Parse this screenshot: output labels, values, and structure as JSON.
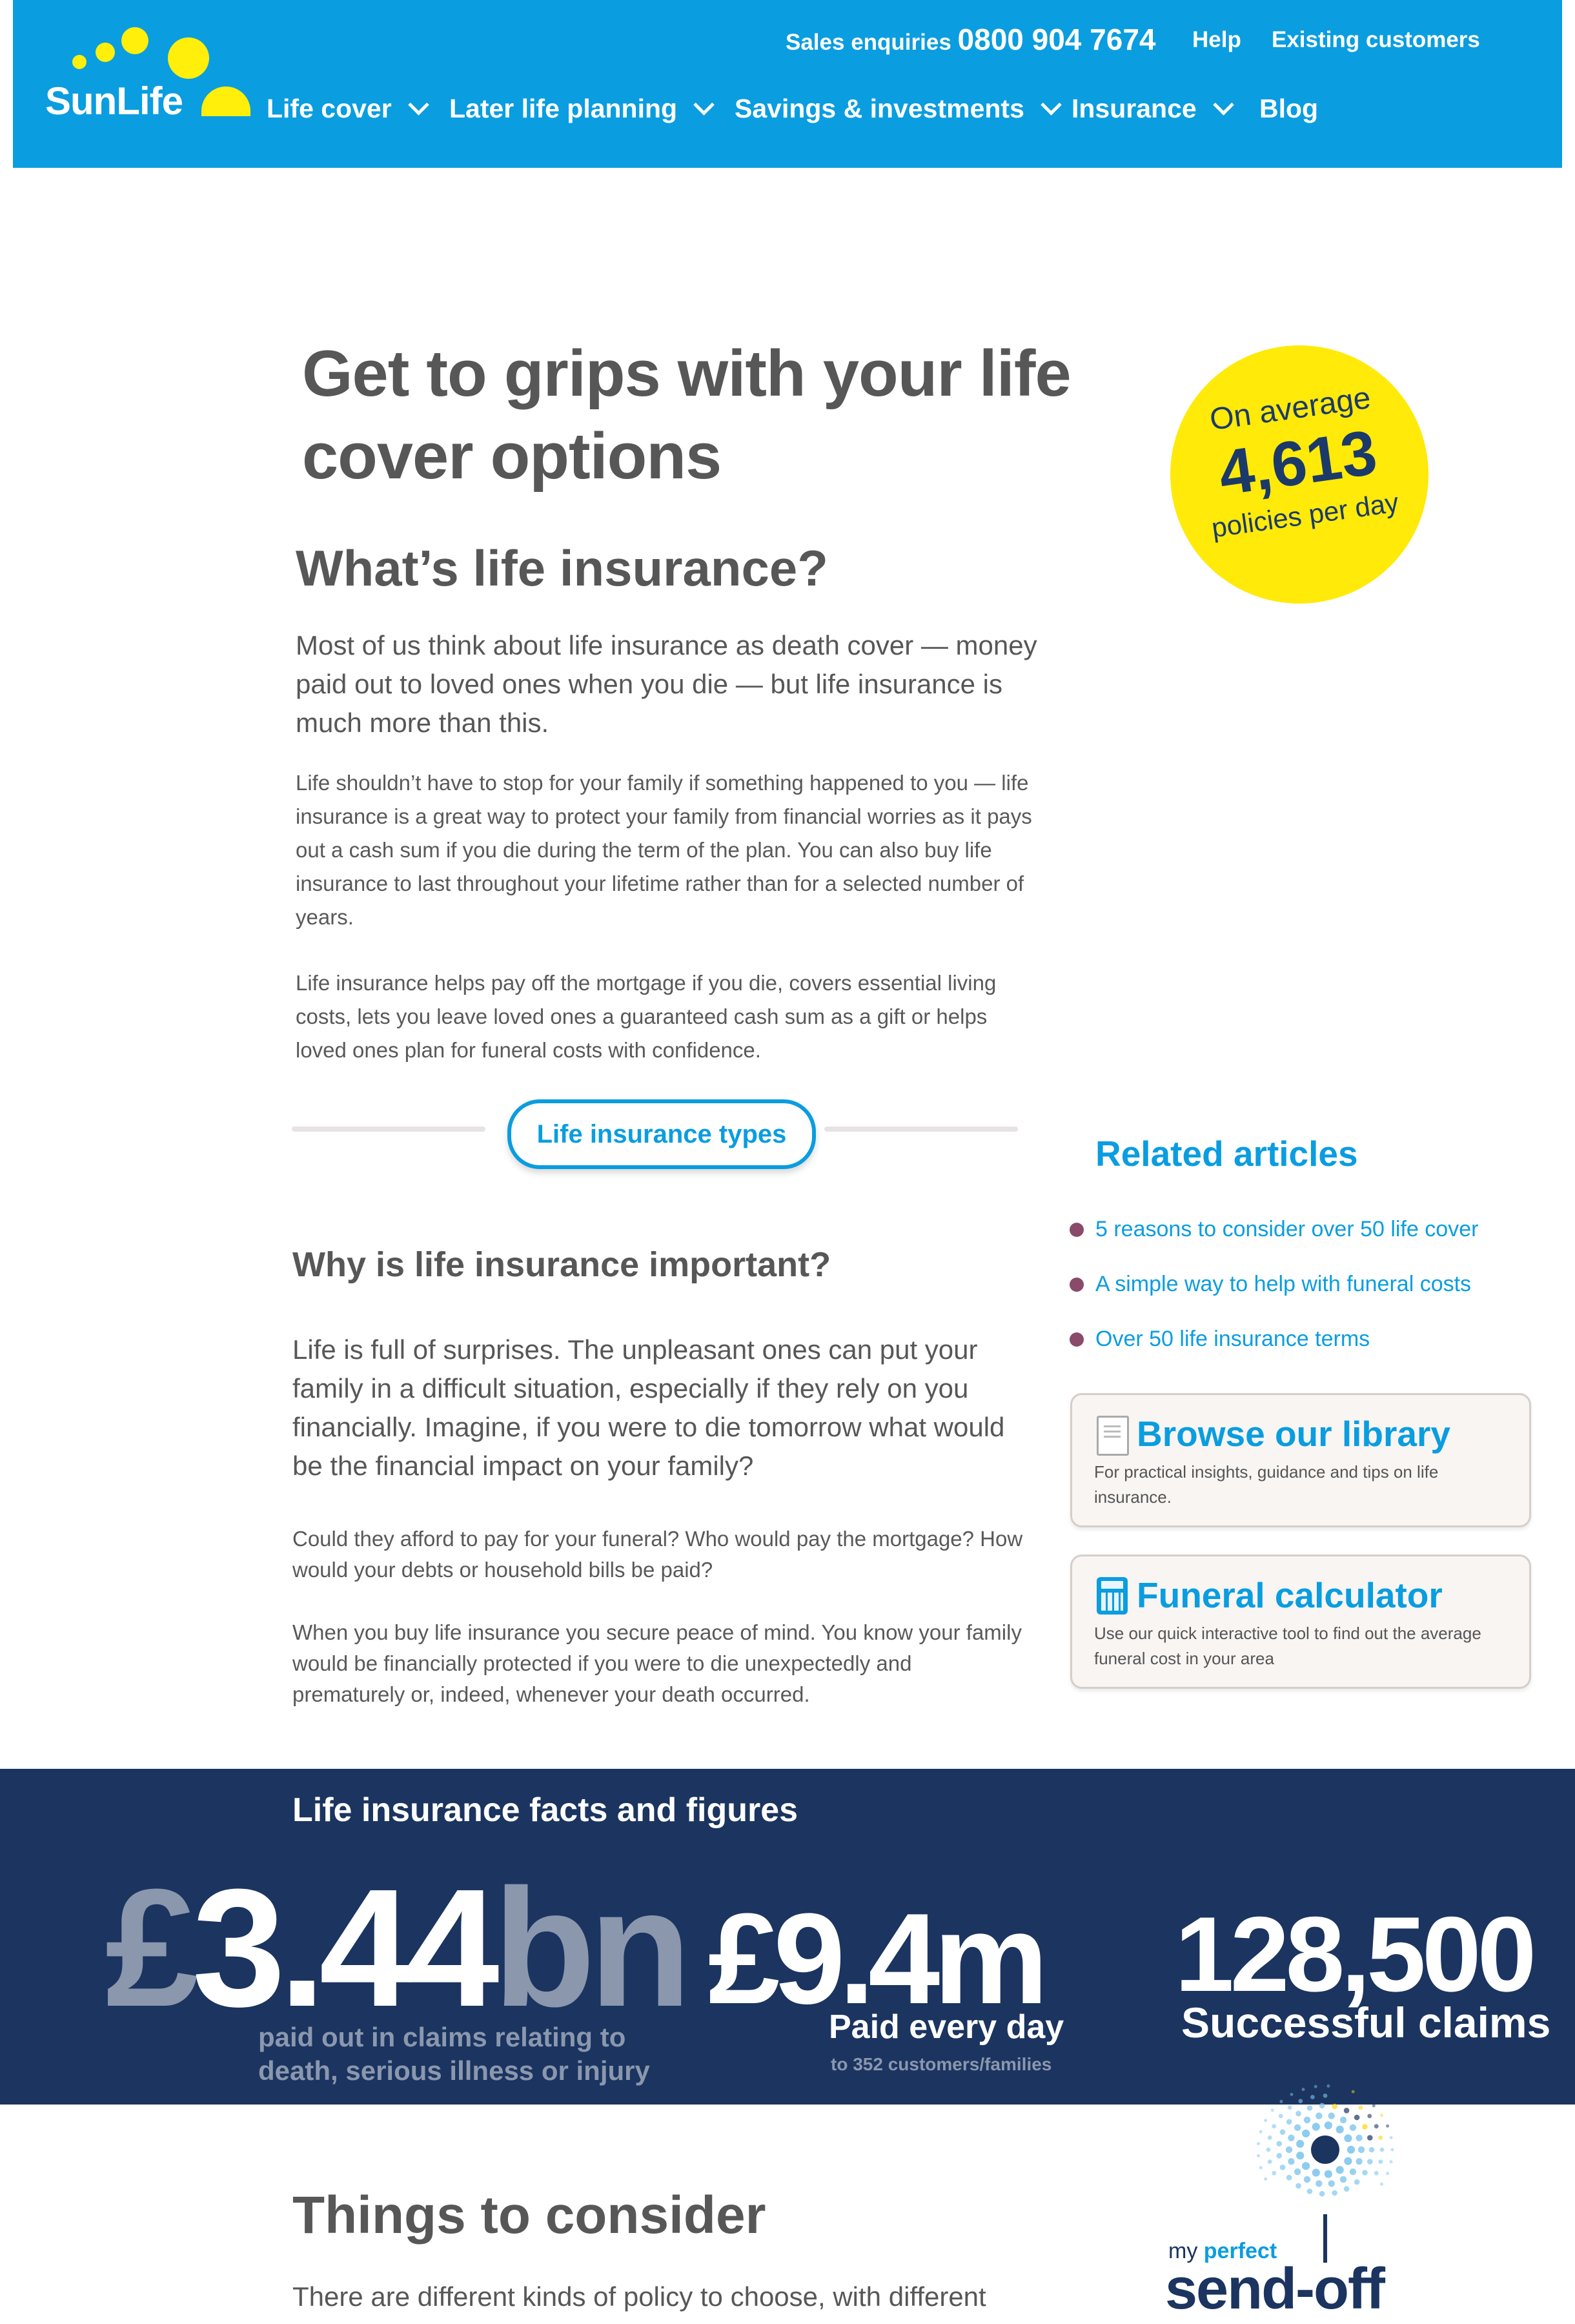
{
  "header": {
    "brand": "SunLife",
    "sales_label": "Sales enquiries",
    "sales_phone": "0800 904 7674",
    "help": "Help",
    "existing": "Existing customers",
    "nav": [
      "Life cover",
      "Later life planning",
      "Savings & investments",
      "Insurance",
      "Blog"
    ]
  },
  "main": {
    "title": "Get to grips with your life cover options",
    "h2_what": "What’s life insurance?",
    "lead_what": "Most of us think about life insurance as death cover — money paid out to loved ones when you die — but life insurance is much more than this.",
    "p1": "Life shouldn’t have to stop for your family if something happened to you — life insurance is a great way to protect your family from financial worries as it pays out a cash sum if you die during the term of the plan. You can also buy life insurance to last throughout your lifetime rather than for a selected number of years.",
    "p2": "Life insurance helps pay off the mortgage if you die, covers essential living costs, lets you leave loved ones a guaranteed cash sum as a gift or helps loved ones plan for funeral costs with confidence.",
    "types_button": "Life insurance types",
    "h2_why": "Why is life insurance important?",
    "lead_why": "Life is full of surprises. The unpleasant ones can put your family in a difficult situation, especially if they rely on you financially. Imagine, if you were to die tomorrow what would be the financial impact on your family?",
    "p3": "Could they afford to pay for your funeral? Who would pay the mortgage? How would your debts or household bills be paid?",
    "p4": "When you buy life insurance you secure peace of mind. You know your family would be financially protected if you were to die unexpectedly and prematurely or, indeed, whenever your death occurred.",
    "h2_things": "Things to consider",
    "p5": "There are different kinds of policy to choose, with different"
  },
  "badge": {
    "line1": "On average",
    "number": "4,613",
    "line3": "policies per day"
  },
  "related": {
    "title": "Related articles",
    "items": [
      "5 reasons to consider over 50 life cover",
      "A simple way to help with funeral costs",
      "Over 50 life insurance terms"
    ]
  },
  "cards": {
    "library_title": "Browse our library",
    "library_text": "For practical insights, guidance and tips on life insurance.",
    "calc_title": "Funeral calculator",
    "calc_text": "Use our quick interactive tool to find out the average funeral cost in your area"
  },
  "facts": {
    "title": "Life insurance facts and figures",
    "stat1_prefix": "£",
    "stat1_value": "3.44",
    "stat1_suffix": "bn",
    "stat1_caption_1": "paid out in claims relating to",
    "stat1_caption_2": "death, serious illness or injury",
    "stat2_value": "£9.4m",
    "stat2_caption": "Paid every day",
    "stat2_subcaption": "to 352 customers/families",
    "stat3_value": "128,500",
    "stat3_caption": "Successful claims"
  },
  "sendoff": {
    "small_1": "my",
    "small_2": "perfect",
    "big": "send-off"
  },
  "colors": {
    "brand_blue": "#0a9de0",
    "brand_yellow": "#ffea0a",
    "navy": "#1b3460",
    "grey_stat": "#8a97ad"
  }
}
